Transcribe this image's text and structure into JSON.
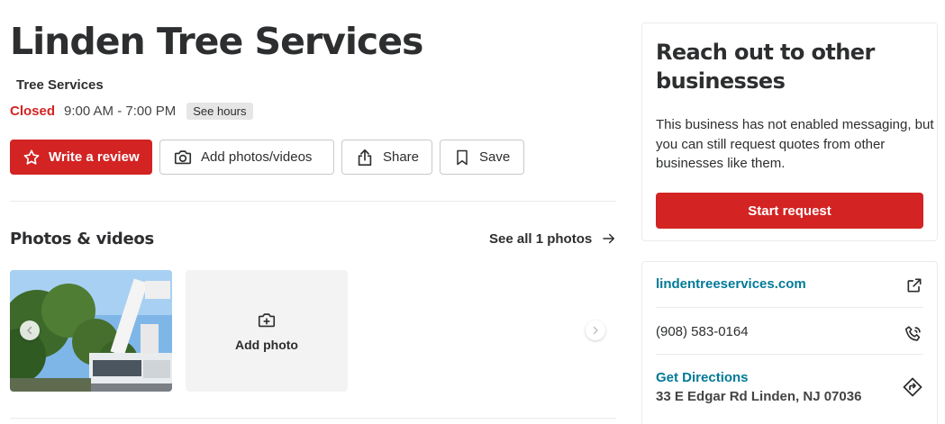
{
  "business": {
    "name": "Linden Tree Services",
    "category": "Tree Services",
    "status": "Closed",
    "hours": "9:00 AM - 7:00 PM",
    "see_hours": "See hours"
  },
  "actions": {
    "write_review": "Write a review",
    "add_photos": "Add photos/videos",
    "share": "Share",
    "save": "Save"
  },
  "photos_section": {
    "title": "Photos & videos",
    "see_all": "See all 1 photos",
    "add_photo": "Add photo"
  },
  "reach_out": {
    "title": "Reach out to other businesses",
    "text": "This business has not enabled messaging, but you can still request quotes from other businesses like them.",
    "button": "Start request"
  },
  "contact": {
    "website": "lindentreeservices.com",
    "phone": "(908) 583-0164",
    "directions_label": "Get Directions",
    "address": "33 E Edgar Rd Linden, NJ 07036"
  },
  "colors": {
    "brand_red": "#d32323",
    "link_teal": "#027a97",
    "text_dark": "#2d2e2f"
  },
  "icons": [
    "star-icon",
    "camera-icon",
    "share-icon",
    "bookmark-icon",
    "arrow-right-icon",
    "add-photo-icon",
    "chevron-left-icon",
    "chevron-right-icon",
    "external-link-icon",
    "phone-icon",
    "directions-icon"
  ]
}
